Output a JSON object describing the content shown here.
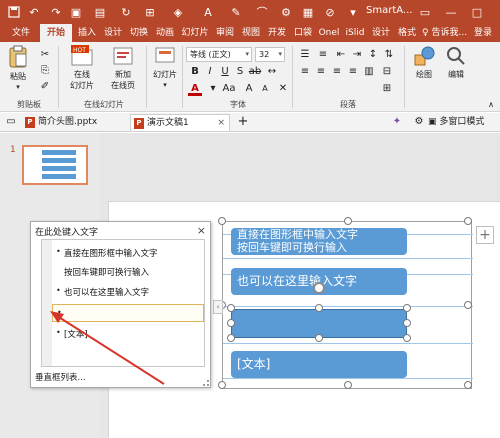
{
  "titlebar": {
    "title": "SmartA...",
    "qat": [
      "save",
      "undo",
      "redo",
      "present"
    ],
    "win_buttons": [
      "ribbon-options",
      "minimize",
      "maximize",
      "close"
    ]
  },
  "tabs": [
    "文件",
    "开始",
    "插入",
    "设计",
    "切换",
    "动画",
    "幻灯片",
    "审阅",
    "视图",
    "开发",
    "口袋",
    "Onel",
    "iSlid",
    "设计",
    "格式"
  ],
  "active_tab": "开始",
  "tabs_right": {
    "tell": "告诉我...",
    "login": "登录"
  },
  "ribbon": {
    "clipboard": {
      "paste": "粘贴",
      "label": "剪贴板"
    },
    "online_slides": {
      "online": "在线\n幻灯片",
      "new_online": "新加\n在线页",
      "badge": "HOT",
      "label": "在线幻灯片"
    },
    "slides": {
      "btn": "幻灯片",
      "label": "幻灯片"
    },
    "font": {
      "name": "等线 (正文)",
      "size": "32",
      "label": "字体",
      "color": "#c00000"
    },
    "paragraph": {
      "label": "段落"
    },
    "drawing": {
      "btn": "绘图"
    },
    "editing": {
      "btn": "编辑"
    }
  },
  "doctabs": {
    "tab1": "简介头图.pptx",
    "tab2": "演示文稿1",
    "new_tab": "+",
    "window_mode": "多窗口模式"
  },
  "slide_number": "1",
  "textpane": {
    "title": "在此处键入文字",
    "items": [
      "直接在图形框中输入文字",
      "按回车键即可换行输入",
      "也可以在这里输入文字",
      "",
      "[文本]"
    ],
    "footer": "垂直框列表..."
  },
  "smartart": {
    "boxes": [
      "直接在图形框中输入文字\n按回车键即可换行输入",
      "也可以在这里输入文字",
      "",
      "[文本]"
    ],
    "fill": "#5b9bd5"
  },
  "colors": {
    "accent": "#b7472a",
    "arrow": "#d9342b"
  }
}
